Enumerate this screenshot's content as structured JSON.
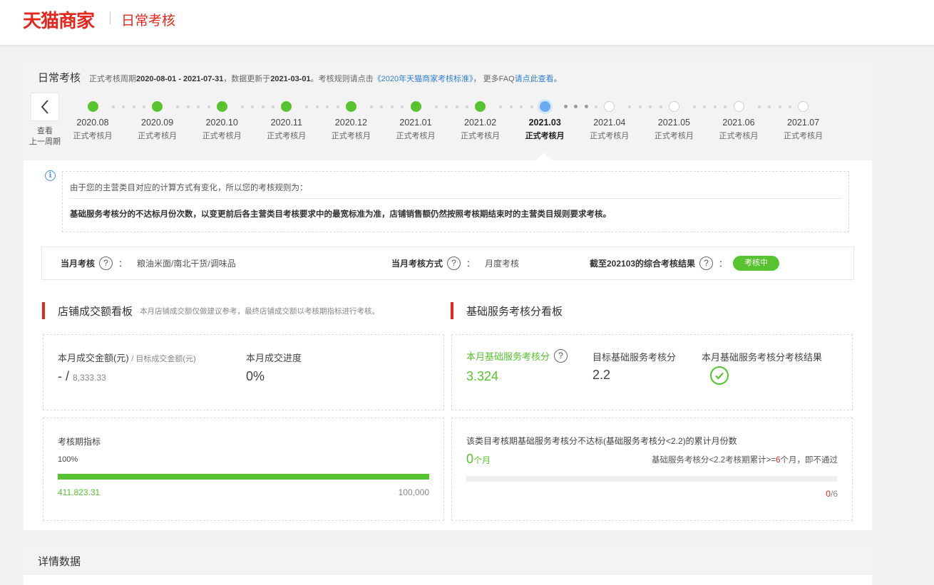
{
  "header": {
    "brand": "天猫商家",
    "title": "日常考核"
  },
  "cycle": {
    "title": "日常考核",
    "desc_prefix": "正式考核周期",
    "period": "2020-08-01 - 2021-07-31",
    "updated_prefix": "，数据更新于",
    "updated": "2021-03-01",
    "rule_prefix": "。考核规则请点击",
    "rule_link": "《2020年天猫商家考核标准》",
    "faq_prefix": "， 更多FAQ",
    "faq_link": "请点此查看",
    "faq_suffix": "。",
    "prev_label_1": "查看",
    "prev_label_2": "上一周期",
    "months": [
      {
        "month": "2020.08",
        "status": "正式考核月",
        "state": "done"
      },
      {
        "month": "2020.09",
        "status": "正式考核月",
        "state": "done"
      },
      {
        "month": "2020.10",
        "status": "正式考核月",
        "state": "done"
      },
      {
        "month": "2020.11",
        "status": "正式考核月",
        "state": "done"
      },
      {
        "month": "2020.12",
        "status": "正式考核月",
        "state": "done"
      },
      {
        "month": "2021.01",
        "status": "正式考核月",
        "state": "done"
      },
      {
        "month": "2021.02",
        "status": "正式考核月",
        "state": "done"
      },
      {
        "month": "2021.03",
        "status": "正式考核月",
        "state": "current"
      },
      {
        "month": "2021.04",
        "status": "正式考核月",
        "state": "future"
      },
      {
        "month": "2021.05",
        "status": "正式考核月",
        "state": "future"
      },
      {
        "month": "2021.06",
        "status": "正式考核月",
        "state": "future"
      },
      {
        "month": "2021.07",
        "status": "正式考核月",
        "state": "future"
      }
    ]
  },
  "notice": {
    "line1": "由于您的主营类目对应的计算方式有变化，所以您的考核规则为：",
    "line2": "基础服务考核分的不达标月份次数，以变更前后各主营类目考核要求中的最宽标准为准，店铺销售额仍然按照考核期结束时的主营类目规则要求考核。"
  },
  "status": {
    "month_assess_label": "当月考核",
    "month_assess_value": "粮油米面/南北干货/调味品",
    "method_label": "当月考核方式",
    "method_value": "月度考核",
    "result_label": "截至202103的综合考核结果",
    "result_badge": "考核中",
    "colon": "："
  },
  "sales": {
    "section_title": "店铺成交额看板",
    "section_note": "本月店铺成交额仅做建议参考，最终店铺成交额以考核期指标进行考核。",
    "amount_label": "本月成交金额(元)",
    "target_label": "/ 目标成交金额(元)",
    "amount_value": "-",
    "slash": "/",
    "target_value": "8,333.33",
    "progress_label": "本月成交进度",
    "progress_value": "0%",
    "period_label": "考核期指标",
    "period_percent": "100%",
    "period_progress": 1.0,
    "period_actual": "411,823.31",
    "period_target": "100,000"
  },
  "service": {
    "section_title": "基础服务考核分看板",
    "score_label": "本月基础服务考核分",
    "score_value": "3.324",
    "target_label": "目标基础服务考核分",
    "target_value": "2.2",
    "result_label": "本月基础服务考核分考核结果",
    "fail_title": "该类目考核期基础服务考核分不达标(基础服务考核分<2.2)的累计月份数",
    "fail_count": "0",
    "fail_unit": "个月",
    "rule_prefix": "基础服务考核分<2.2考核期累计>=",
    "rule_num": "6",
    "rule_suffix": "个月，即不通过",
    "count_current": "0",
    "count_total": "/6",
    "fail_progress": 0
  },
  "details": {
    "title": "详情数据"
  },
  "colors": {
    "brand_red": "#e4261c",
    "success_green": "#57c32e",
    "current_blue": "#6aaaf0",
    "link_blue": "#2f7fd5"
  }
}
